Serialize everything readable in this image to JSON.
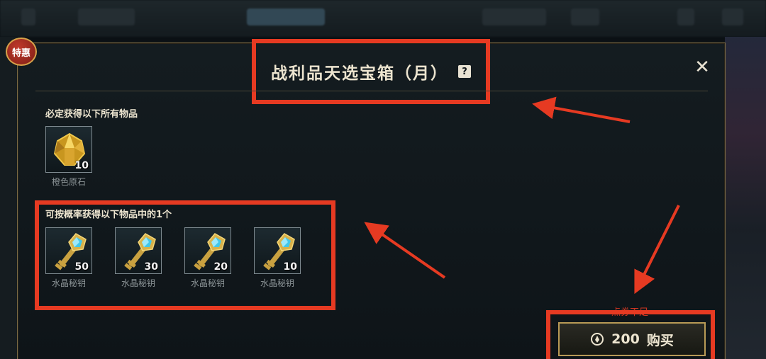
{
  "promo": {
    "badge": "特惠"
  },
  "dialog": {
    "title": "战利品天选宝箱（月）",
    "help": "?",
    "close": "✕"
  },
  "guaranteed": {
    "label": "必定获得以下所有物品",
    "items": [
      {
        "name": "橙色原石",
        "qty": "10",
        "icon": "orange-essence-gem-icon"
      }
    ]
  },
  "random": {
    "label": "可按概率获得以下物品中的1个",
    "items": [
      {
        "name": "水晶秘钥",
        "qty": "50",
        "icon": "crystal-key-icon"
      },
      {
        "name": "水晶秘钥",
        "qty": "30",
        "icon": "crystal-key-icon"
      },
      {
        "name": "水晶秘钥",
        "qty": "20",
        "icon": "crystal-key-icon"
      },
      {
        "name": "水晶秘钥",
        "qty": "10",
        "icon": "crystal-key-icon"
      }
    ]
  },
  "purchase": {
    "price": "200",
    "label": "购买",
    "hint": "点券不足",
    "currency_icon": "rp-coin-icon"
  },
  "colors": {
    "annotation_red": "#e63a22",
    "gold_border": "#b89a56",
    "panel_bg": "#141c20"
  }
}
